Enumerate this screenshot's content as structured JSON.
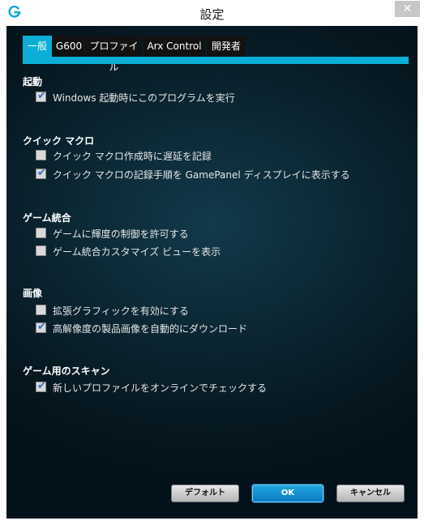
{
  "window": {
    "title": "設定",
    "close_glyph": "✕"
  },
  "tabs": [
    {
      "label": "一般",
      "active": true
    },
    {
      "label": "G600",
      "active": false
    },
    {
      "label": "プロファイル",
      "active": false
    },
    {
      "label": "Arx Control",
      "active": false
    },
    {
      "label": "開発者",
      "active": false
    }
  ],
  "sections": {
    "startup": {
      "heading": "起動",
      "options": [
        {
          "label": "Windows 起動時にこのプログラムを実行",
          "checked": true
        }
      ]
    },
    "quick_macro": {
      "heading": "クイック マクロ",
      "options": [
        {
          "label": "クイック マクロ作成時に遅延を記録",
          "checked": false
        },
        {
          "label": "クイック マクロの記録手順を GamePanel ディスプレイに表示する",
          "checked": true
        }
      ]
    },
    "game_integration": {
      "heading": "ゲーム統合",
      "options": [
        {
          "label": "ゲームに輝度の制御を許可する",
          "checked": false
        },
        {
          "label": "ゲーム統合カスタマイズ ビューを表示",
          "checked": false
        }
      ]
    },
    "images": {
      "heading": "画像",
      "options": [
        {
          "label": "拡張グラフィックを有効にする",
          "checked": false
        },
        {
          "label": "高解像度の製品画像を自動的にダウンロード",
          "checked": true
        }
      ]
    },
    "game_scan": {
      "heading": "ゲーム用のスキャン",
      "options": [
        {
          "label": "新しいプロファイルをオンラインでチェックする",
          "checked": true
        }
      ]
    }
  },
  "buttons": {
    "default_label": "デフォルト",
    "ok_label": "OK",
    "cancel_label": "キャンセル"
  },
  "colors": {
    "accent": "#0aaed6",
    "background_dark": "#061720",
    "check_color": "#2f6fc8"
  },
  "icons": {
    "app": "logitech-g-icon",
    "close": "close-icon",
    "check": "check-icon"
  }
}
